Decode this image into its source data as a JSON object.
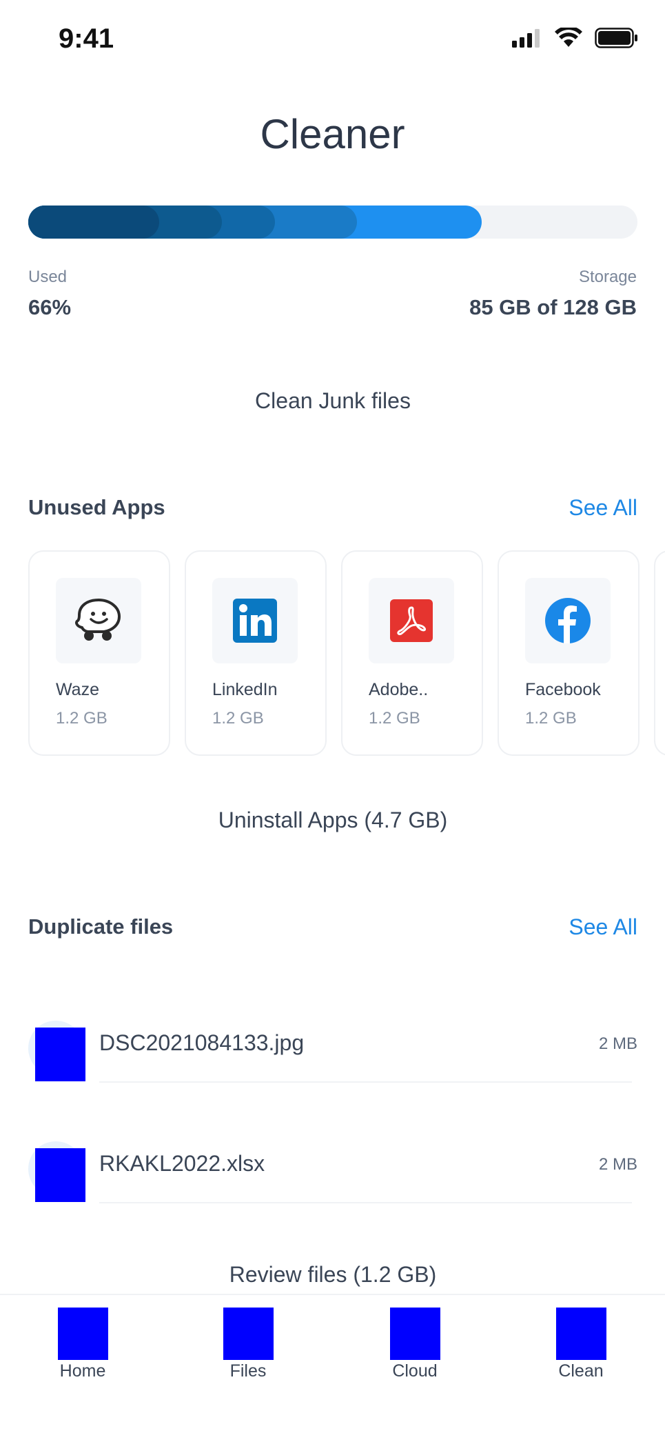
{
  "status": {
    "time": "9:41",
    "icons": [
      "signal-icon",
      "wifi-icon",
      "battery-icon"
    ]
  },
  "header": {
    "title": "Cleaner"
  },
  "storage": {
    "used_label": "Used",
    "used_value": "66%",
    "used_fraction": 0.66,
    "storage_label": "Storage",
    "storage_value": "85 GB of 128 GB",
    "segment_colors": [
      "#0b4a7a",
      "#0d5a8f",
      "#1168a8",
      "#1a7bc7",
      "#1e90f0"
    ],
    "track_color": "#f1f3f6"
  },
  "actions": {
    "clean_junk": "Clean Junk files",
    "uninstall_apps": "Uninstall Apps (4.7 GB)",
    "review_files": "Review files (1.2 GB)"
  },
  "unused_apps": {
    "title": "Unused Apps",
    "see_all": "See All",
    "items": [
      {
        "name": "Waze",
        "size": "1.2 GB",
        "icon": "waze-icon"
      },
      {
        "name": "LinkedIn",
        "size": "1.2 GB",
        "icon": "linkedin-icon"
      },
      {
        "name": "Adobe..",
        "size": "1.2 GB",
        "icon": "adobe-acrobat-icon"
      },
      {
        "name": "Facebook",
        "size": "1.2 GB",
        "icon": "facebook-icon"
      }
    ]
  },
  "duplicate_files": {
    "title": "Duplicate files",
    "see_all": "See All",
    "items": [
      {
        "name": "DSC2021084133.jpg",
        "size": "2 MB",
        "icon": "image-file-icon"
      },
      {
        "name": "RKAKL2022.xlsx",
        "size": "2 MB",
        "icon": "spreadsheet-file-icon"
      }
    ]
  },
  "tabs": [
    {
      "label": "Home",
      "icon": "home-icon"
    },
    {
      "label": "Files",
      "icon": "files-icon"
    },
    {
      "label": "Cloud",
      "icon": "cloud-icon"
    },
    {
      "label": "Clean",
      "icon": "clean-icon"
    }
  ],
  "colors": {
    "accent": "#1e88e5",
    "text": "#3a4556",
    "muted": "#8b95a5",
    "placeholder_icon": "#0000ff"
  }
}
